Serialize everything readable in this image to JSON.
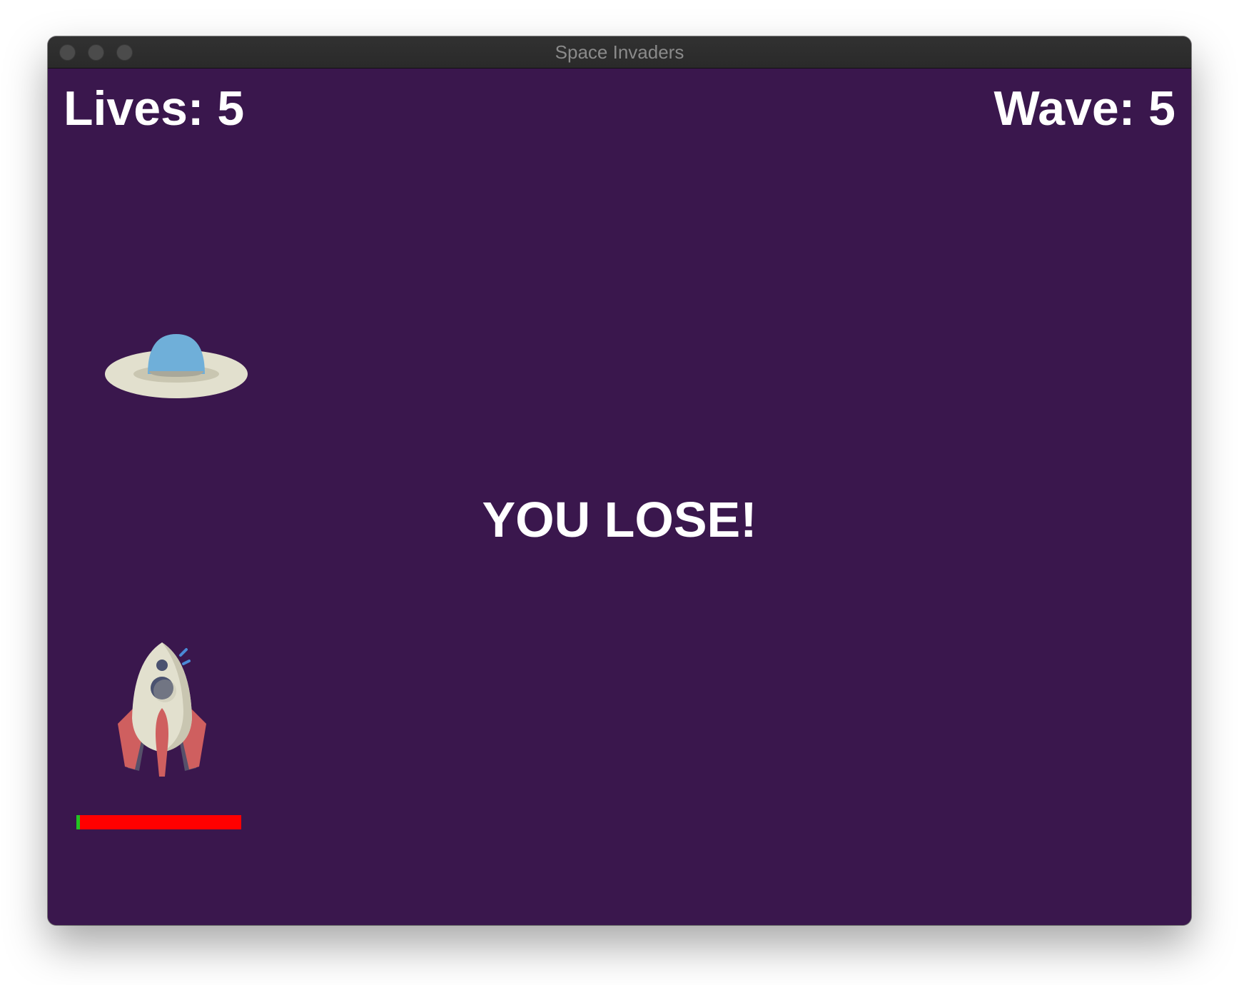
{
  "window": {
    "title": "Space Invaders"
  },
  "hud": {
    "lives_text": "Lives: 5",
    "wave_text": "Wave: 5"
  },
  "message": "YOU LOSE!",
  "player": {
    "health_fraction": 0.02,
    "health_color": "#22c422",
    "damage_color": "#ff0000"
  },
  "colors": {
    "background": "#3a174d",
    "hud_text": "#ffffff",
    "ufo_dome": "#6fafd9",
    "ufo_saucer": "#e2e0ce",
    "rocket_body": "#e2e0ce",
    "rocket_fins": "#cf5f5f"
  },
  "icons": {
    "enemy": "ufo-icon",
    "player": "rocket-icon"
  }
}
